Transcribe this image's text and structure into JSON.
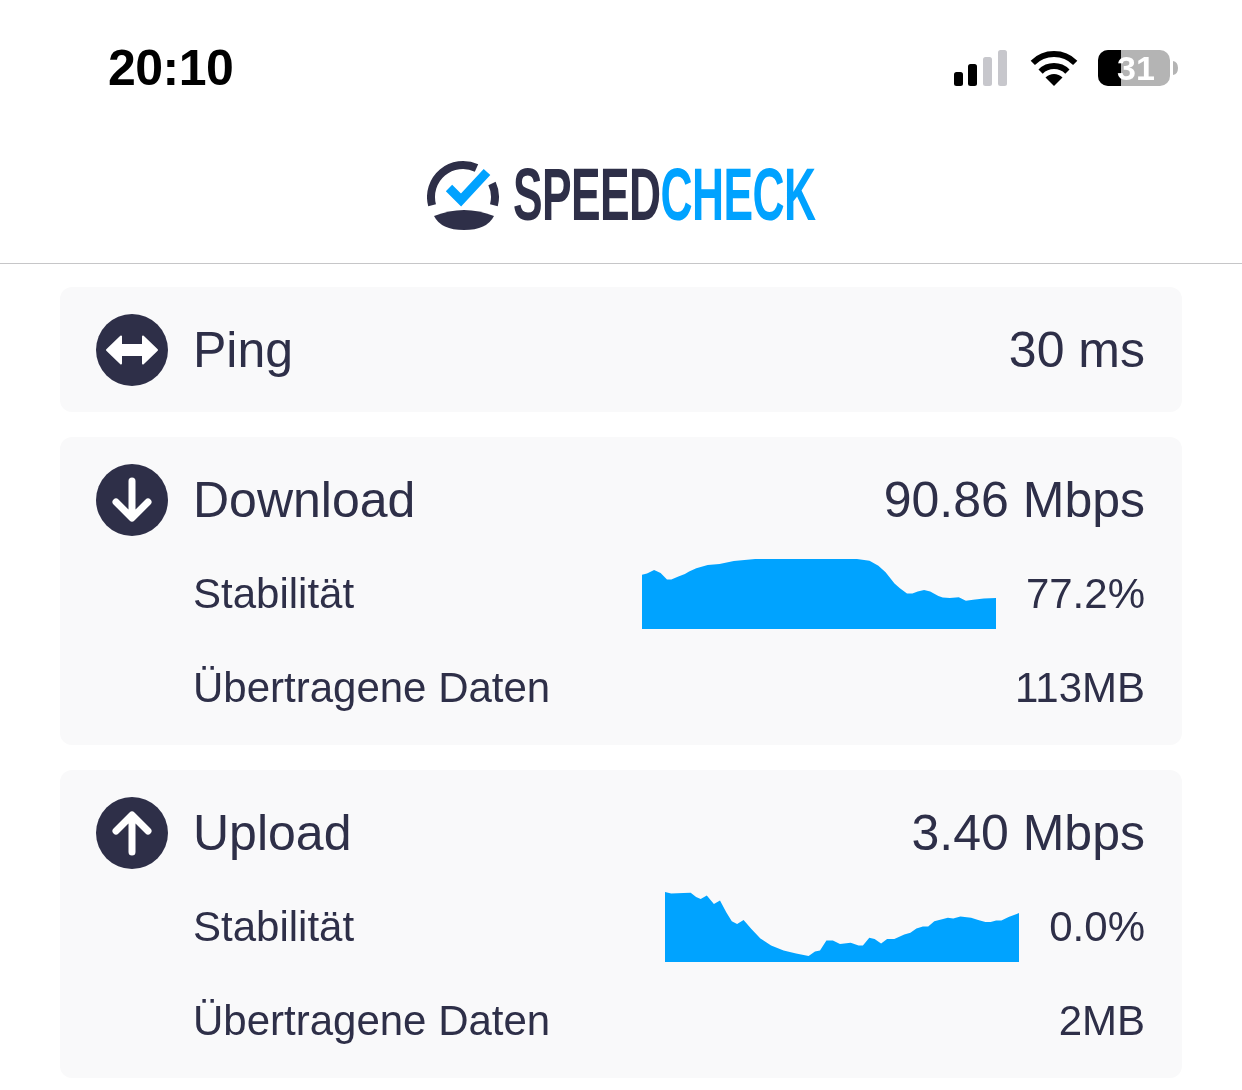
{
  "status_bar": {
    "time": "20:10",
    "battery": "31"
  },
  "header": {
    "logo_word": "SPEED",
    "logo_accent": "CHECK"
  },
  "results": [
    {
      "kind": "ping",
      "label": "Ping",
      "value": "30 ms"
    },
    {
      "kind": "download",
      "label": "Download",
      "value": "90.86 Mbps",
      "details": [
        {
          "kind": "stability",
          "label": "Stabilität",
          "value": "77.2%"
        },
        {
          "kind": "transfer",
          "label": "Übertragene Daten",
          "value": "113MB"
        }
      ]
    },
    {
      "kind": "upload",
      "label": "Upload",
      "value": "3.40 Mbps",
      "details": [
        {
          "kind": "stability",
          "label": "Stabilität",
          "value": "0.0%"
        },
        {
          "kind": "transfer",
          "label": "Übertragene Daten",
          "value": "2MB"
        }
      ]
    }
  ]
}
